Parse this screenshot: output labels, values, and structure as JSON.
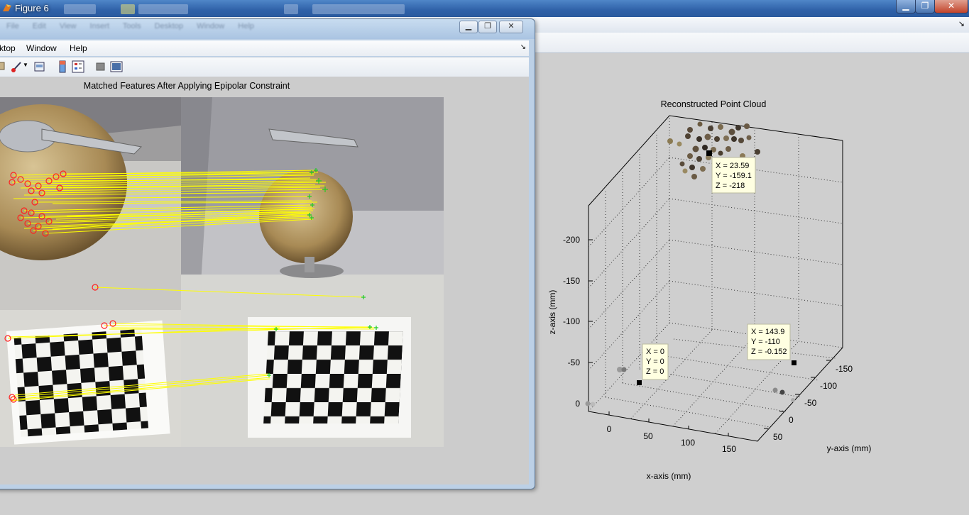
{
  "back_window": {
    "title": "Figure 6",
    "controls": {
      "minimize": "▁",
      "maximize": "❐",
      "close": "✕"
    },
    "menu_arrow": "↘",
    "plot": {
      "title": "Reconstructed Point Cloud",
      "xlabel": "x-axis (mm)",
      "ylabel": "y-axis (mm)",
      "zlabel": "z-axis (mm)",
      "z_ticks": [
        "-200",
        "-150",
        "-100",
        "-50",
        "0"
      ],
      "x_ticks": [
        "0",
        "50",
        "100",
        "150"
      ],
      "y_ticks": [
        "-150",
        "-100",
        "-50",
        "0",
        "50"
      ],
      "datatips": [
        {
          "lines": [
            "X = 23.59",
            "Y = -159.1",
            "Z = -218"
          ]
        },
        {
          "lines": [
            "X = 143.9",
            "Y = -110",
            "Z = -0.152"
          ]
        },
        {
          "lines": [
            "X = 0",
            "Y = 0",
            "Z = 0"
          ]
        }
      ]
    }
  },
  "front_window": {
    "ghost_menu": [
      "File",
      "Edit",
      "View",
      "Insert",
      "Tools",
      "Desktop",
      "Window",
      "Help"
    ],
    "controls": {
      "minimize": "▁",
      "maximize": "❐",
      "close": "✕"
    },
    "menu": {
      "desktop": "ktop",
      "window": "Window",
      "help": "Help"
    },
    "menu_arrow": "↘",
    "toolbar": [
      "print-icon",
      "brush-icon",
      "print-preview-icon",
      "colorbar-icon",
      "legend-icon",
      "hide-plot-tools-icon",
      "show-plot-tools-icon"
    ],
    "plot_title": "Matched Features After Applying Epipolar Constraint"
  }
}
